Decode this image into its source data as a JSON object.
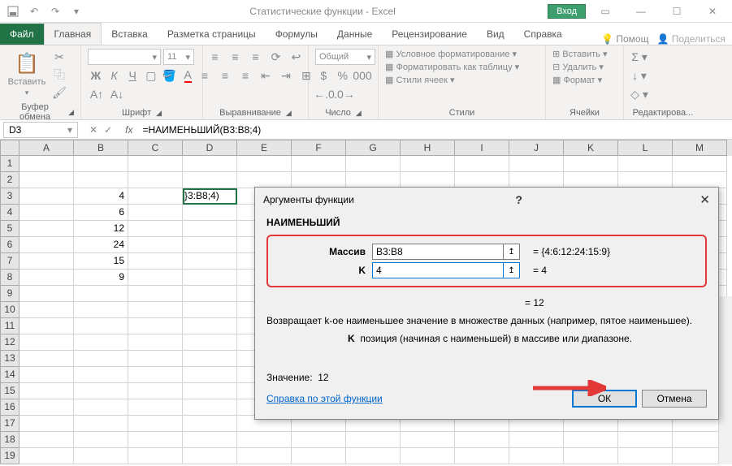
{
  "title": "Статистические функции - Excel",
  "login_label": "Вход",
  "tabs": {
    "file": "Файл",
    "home": "Главная",
    "insert": "Вставка",
    "layout": "Разметка страницы",
    "formulas": "Формулы",
    "data": "Данные",
    "review": "Рецензирование",
    "view": "Вид",
    "help": "Справка",
    "tell_me": "Помощ",
    "share": "Поделиться"
  },
  "ribbon": {
    "clipboard": {
      "paste": "Вставить",
      "label": "Буфер обмена"
    },
    "font": {
      "label": "Шрифт",
      "size": "11"
    },
    "alignment": {
      "label": "Выравнивание"
    },
    "number": {
      "format": "Общий",
      "label": "Число"
    },
    "styles": {
      "cond": "Условное форматирование",
      "table": "Форматировать как таблицу",
      "cell": "Стили ячеек",
      "label": "Стили"
    },
    "cells": {
      "insert": "Вставить",
      "delete": "Удалить",
      "format": "Формат",
      "label": "Ячейки"
    },
    "editing": {
      "label": "Редактирова..."
    }
  },
  "name_box": "D3",
  "formula": "=НАИМЕНЬШИЙ(B3:B8;4)",
  "columns": [
    "A",
    "B",
    "C",
    "D",
    "E",
    "F",
    "G",
    "H",
    "I",
    "J",
    "K",
    "L",
    "M"
  ],
  "rows": {
    "3": {
      "B": "4",
      "D": "}3:B8;4)"
    },
    "4": {
      "B": "6"
    },
    "5": {
      "B": "12"
    },
    "6": {
      "B": "24"
    },
    "7": {
      "B": "15"
    },
    "8": {
      "B": "9"
    }
  },
  "dialog": {
    "title": "Аргументы функции",
    "func": "НАИМЕНЬШИЙ",
    "arg1_label": "Массив",
    "arg1_value": "B3:B8",
    "arg1_result": "=  {4:6:12:24:15:9}",
    "arg2_label": "K",
    "arg2_value": "4",
    "arg2_result": "=  4",
    "overall_result": "=  12",
    "desc1": "Возвращает k-ое наименьшее значение в множестве данных (например, пятое наименьшее).",
    "desc2_label": "K",
    "desc2": "позиция (начиная с наименьшей) в массиве или диапазоне.",
    "value_label": "Значение:",
    "value": "12",
    "help_link": "Справка по этой функции",
    "ok": "ОК",
    "cancel": "Отмена"
  }
}
